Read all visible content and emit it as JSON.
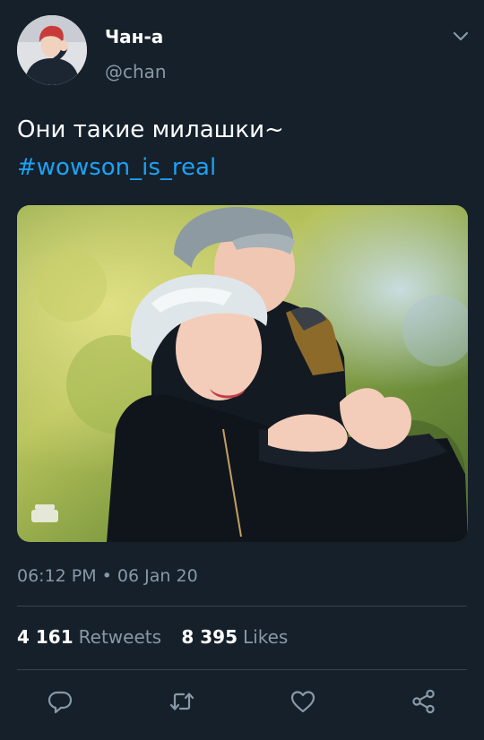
{
  "author": {
    "display_name": "Чан-а",
    "handle": "@chan"
  },
  "tweet": {
    "text": "Они такие милашки~",
    "hashtag": "#wowson_is_real",
    "timestamp": "06:12 PM • 06 Jan 20"
  },
  "stats": {
    "retweets_count": "4 161",
    "retweets_label": "Retweets",
    "likes_count": "8 395",
    "likes_label": "Likes"
  },
  "icons": {
    "caret": "chevron-down-icon",
    "reply": "reply-icon",
    "retweet": "retweet-icon",
    "like": "heart-icon",
    "share": "share-icon"
  },
  "colors": {
    "background": "#15202b",
    "secondary_text": "#8899a6",
    "link": "#1da1f2",
    "divider": "#38444d"
  }
}
